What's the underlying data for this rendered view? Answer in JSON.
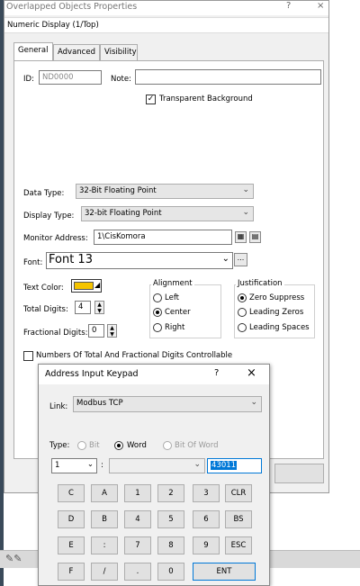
{
  "window": {
    "title": "Overlapped Objects Properties",
    "help": "?",
    "close": "×"
  },
  "object_header": "Numeric Display (1/Top)",
  "tabs": [
    "General",
    "Advanced",
    "Visibility"
  ],
  "general": {
    "id_label": "ID:",
    "id_value": "ND0000",
    "note_label": "Note:",
    "note_value": "",
    "transparent_bg_label": "Transparent Background",
    "transparent_bg_checked": true,
    "data_type_label": "Data Type:",
    "data_type_value": "32-Bit Floating Point",
    "display_type_label": "Display Type:",
    "display_type_value": "32-bit Floating Point",
    "monitor_address_label": "Monitor Address:",
    "monitor_address_value": "1\\CisKomora",
    "font_label": "Font:",
    "font_value": "Font 13",
    "font_more": "...",
    "text_color_label": "Text Color:",
    "text_color_hex": "#f5c400",
    "total_digits_label": "Total Digits:",
    "total_digits_value": "4",
    "fractional_digits_label": "Fractional Digits:",
    "fractional_digits_value": "0",
    "alignment": {
      "title": "Alignment",
      "options": [
        "Left",
        "Center",
        "Right"
      ],
      "selected": "Center"
    },
    "justification": {
      "title": "Justification",
      "options": [
        "Zero Suppress",
        "Leading Zeros",
        "Leading Spaces"
      ],
      "selected": "Zero Suppress"
    },
    "digits_controllable_label": "Numbers Of Total And Fractional Digits Controllable"
  },
  "keypad": {
    "title": "Address Input Keypad",
    "help": "?",
    "close": "×",
    "link_label": "Link:",
    "link_value": "Modbus TCP",
    "type_label": "Type:",
    "type_options": [
      "Bit",
      "Word",
      "Bit Of Word"
    ],
    "type_selected": "Word",
    "station_value": "1",
    "colon": ":",
    "address_value": "43011",
    "keys": [
      [
        "C",
        "A",
        "1",
        "2",
        "3",
        "CLR"
      ],
      [
        "D",
        "B",
        "4",
        "5",
        "6",
        "BS"
      ],
      [
        "E",
        ":",
        "7",
        "8",
        "9",
        "ESC"
      ],
      [
        "F",
        "/",
        ".",
        "0",
        "ENT"
      ]
    ]
  }
}
